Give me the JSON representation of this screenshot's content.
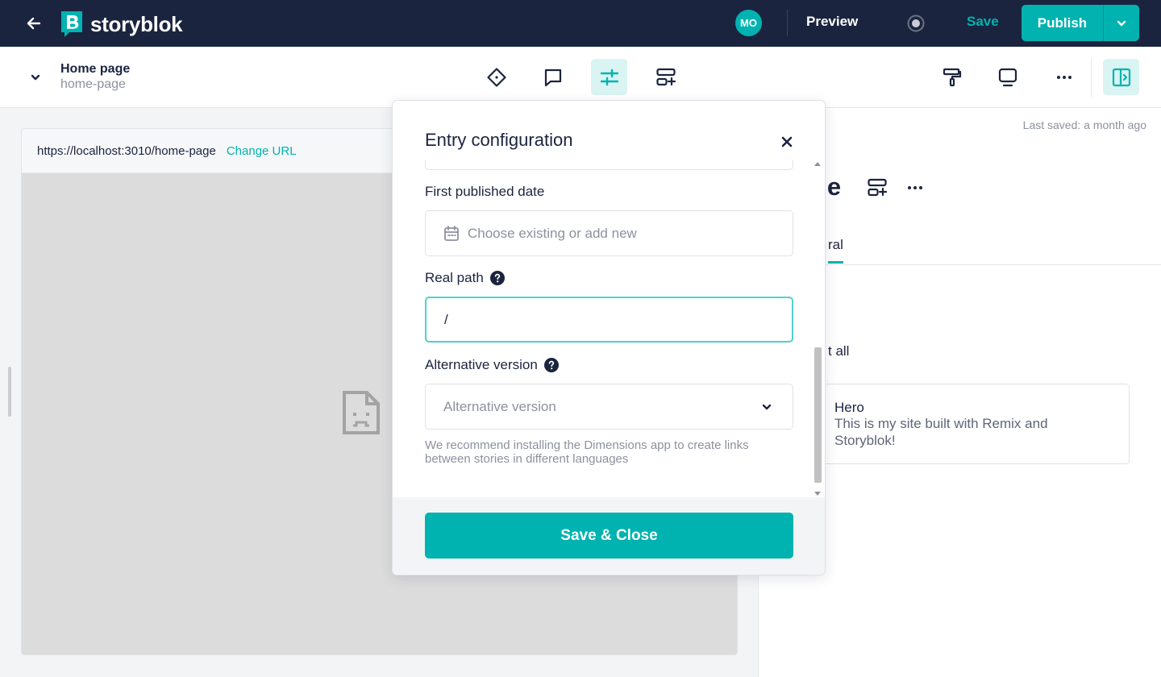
{
  "topbar": {
    "logo_text": "storyblok",
    "avatar_initials": "MO",
    "preview_label": "Preview",
    "save_label": "Save",
    "publish_label": "Publish"
  },
  "story": {
    "title": "Home page",
    "slug": "home-page"
  },
  "toolbar_icons": [
    "diamond-icon",
    "comment-icon",
    "sliders-icon",
    "add-block-icon",
    "paint-roller-icon",
    "monitor-icon",
    "more-icon",
    "sidebar-toggle-icon"
  ],
  "preview": {
    "url": "https://localhost:3010/home-page",
    "change_url_label": "Change URL"
  },
  "right_panel": {
    "last_saved": "Last saved: a month ago",
    "title_visible": "ge",
    "tab_visible": "ral",
    "list_label_visible": "t all",
    "block": {
      "name": "Hero",
      "description": "This is my site built with Remix and Storyblok!"
    }
  },
  "modal": {
    "title": "Entry configuration",
    "first_published": {
      "label": "First published date",
      "placeholder": "Choose existing or add new"
    },
    "real_path": {
      "label": "Real path",
      "value": "/"
    },
    "alternative_version": {
      "label": "Alternative version",
      "placeholder": "Alternative version",
      "hint": "We recommend installing the Dimensions app to create links between stories in different languages"
    },
    "save_close_label": "Save & Close"
  },
  "colors": {
    "navy": "#1b243f",
    "teal": "#00b3b0",
    "teal_light": "#d9f4f3"
  }
}
